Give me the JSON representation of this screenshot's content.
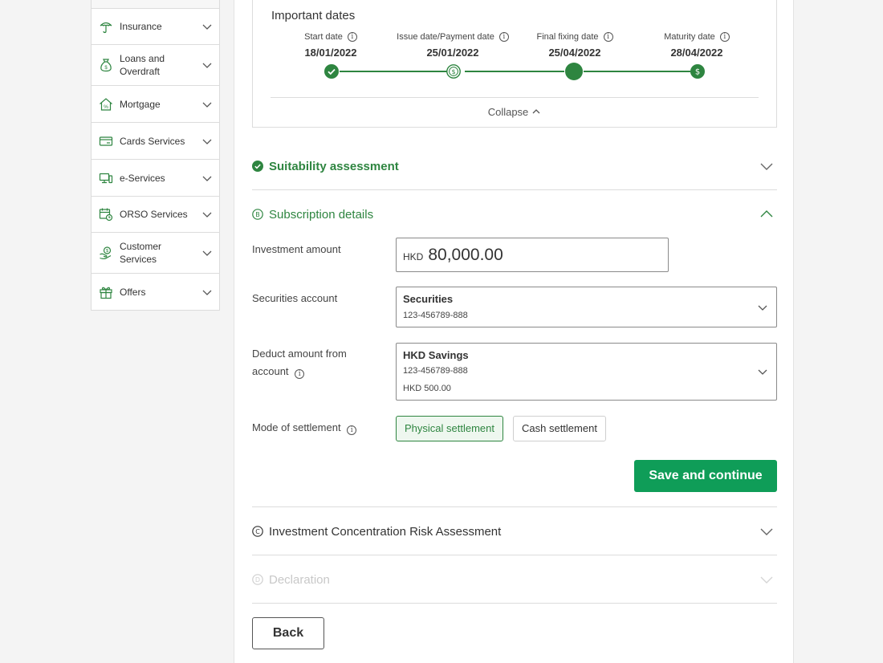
{
  "sidebar": {
    "items": [
      {
        "label": "Insurance",
        "icon": "umbrella-icon"
      },
      {
        "label": "Loans and Overdraft",
        "icon": "money-bag-icon"
      },
      {
        "label": "Mortgage",
        "icon": "house-percent-icon"
      },
      {
        "label": "Cards Services",
        "icon": "credit-card-icon"
      },
      {
        "label": "e-Services",
        "icon": "computer-icon"
      },
      {
        "label": "ORSO Services",
        "icon": "calendar-clock-icon"
      },
      {
        "label": "Customer Services",
        "icon": "hand-coin-icon"
      },
      {
        "label": "Offers",
        "icon": "gift-icon"
      }
    ]
  },
  "important_dates": {
    "title": "Important dates",
    "milestones": [
      {
        "label": "Start date",
        "date": "18/01/2022",
        "status": "completed"
      },
      {
        "label": "Issue date/Payment date",
        "date": "25/01/2022",
        "status": "payment"
      },
      {
        "label": "Final fixing date",
        "date": "25/04/2022",
        "status": "current"
      },
      {
        "label": "Maturity date",
        "date": "28/04/2022",
        "status": "payment"
      }
    ],
    "collapse_label": "Collapse"
  },
  "sections": {
    "suitability": {
      "badge": "✓",
      "title": "Suitability assessment"
    },
    "subscription": {
      "badge": "B",
      "title": "Subscription details"
    },
    "concentration": {
      "badge": "C",
      "title": "Investment Concentration Risk Assessment"
    },
    "declaration": {
      "badge": "D",
      "title": "Declaration"
    }
  },
  "form": {
    "investment_amount_label": "Investment amount",
    "investment_currency": "HKD",
    "investment_amount": "80,000.00",
    "securities_account_label": "Securities account",
    "securities_account": {
      "name": "Securities",
      "number": "123-456789-888"
    },
    "deduct_label_line1": "Deduct amount from",
    "deduct_label_line2": "account",
    "deduct_account": {
      "name": "HKD Savings",
      "number": "123-456789-888",
      "balance": "HKD 500.00"
    },
    "settlement_label": "Mode of settlement",
    "settlement_options": [
      "Physical settlement",
      "Cash settlement"
    ],
    "settlement_selected": "Physical settlement"
  },
  "buttons": {
    "save_continue": "Save and continue",
    "back": "Back"
  },
  "colors": {
    "accent_green": "#2e8540",
    "primary_button": "#0f9d58",
    "disabled_text": "#c8c8c8"
  }
}
